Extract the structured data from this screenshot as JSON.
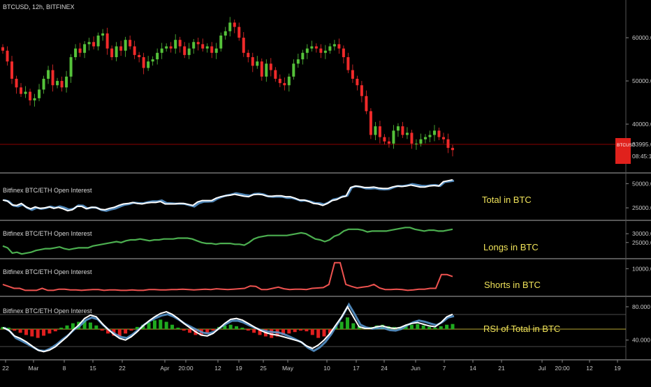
{
  "header": {
    "symbol": "BTCUSD",
    "interval": "12h",
    "exchange": "BITFINEX",
    "title": "BTCUSD, 12h, BITFINEX"
  },
  "colors": {
    "bg": "#000000",
    "up": "#55c23a",
    "down": "#f02a2a",
    "total": "#ffffff",
    "total_shadow": "#5b9bd5",
    "longs": "#4caf50",
    "shorts": "#ef5350",
    "annotation": "#f0e35a",
    "hist_up": "#1faa1f",
    "hist_down": "#e01f1f",
    "price_tag": "#e0211c",
    "rsi_level": "#b8a733"
  },
  "price_tag": {
    "label": "BTCUSD",
    "price": "33995.0",
    "countdown": "08:45:14"
  },
  "chart_data": [
    {
      "type": "candlestick",
      "title": "BTCUSD, 12h, BITFINEX",
      "y_ticks": [
        "60000.0",
        "50000.0",
        "40000.0"
      ],
      "ylim": [
        30000,
        65500
      ],
      "series": [
        {
          "name": "close",
          "values": [
            57000,
            54500,
            50500,
            48500,
            47000,
            47500,
            45500,
            46000,
            48000,
            50500,
            52500,
            49000,
            50000,
            48500,
            51000,
            55500,
            57500,
            56500,
            58500,
            59000,
            58000,
            60500,
            61000,
            57500,
            55500,
            58000,
            57000,
            59500,
            58000,
            56000,
            55500,
            53000,
            54500,
            55000,
            56500,
            57500,
            58000,
            57500,
            59500,
            58000,
            56000,
            57500,
            59000,
            58500,
            57500,
            58000,
            56500,
            57500,
            60500,
            61500,
            63500,
            62500,
            60000,
            56500,
            55500,
            53500,
            54500,
            51000,
            54000,
            52500,
            50500,
            49500,
            49000,
            51000,
            54000,
            55000,
            56500,
            57500,
            58000,
            57500,
            56500,
            57000,
            58000,
            58500,
            57500,
            55500,
            52500,
            50500,
            49000,
            46500,
            43000,
            37500,
            39500,
            37000,
            36000,
            35500,
            38500,
            39500,
            37500,
            38000,
            35500,
            35500,
            36500,
            37000,
            37500,
            38500,
            37000,
            36500,
            34500,
            34000
          ]
        }
      ]
    },
    {
      "type": "line",
      "series": [
        {
          "name": "Total in BTC",
          "values": [
            33000,
            32000,
            28000,
            27500,
            29500,
            26000,
            24000,
            26000,
            24500,
            25000,
            26000,
            24500,
            25500,
            24000,
            22000,
            23000,
            26500,
            26500,
            24000,
            25500,
            25500,
            23500,
            23000,
            24500,
            25500,
            27500,
            29000,
            29500,
            30500,
            29500,
            29000,
            30000,
            30500,
            30500,
            31500,
            29000,
            29000,
            29000,
            29500,
            29500,
            28500,
            27500,
            31000,
            32500,
            32500,
            32500,
            35000,
            36500,
            37500,
            38000,
            39000,
            38000,
            37000,
            36500,
            38500,
            39000,
            38500,
            37000,
            37000,
            37500,
            37500,
            36500,
            36500,
            35000,
            33000,
            33000,
            31500,
            29500,
            29000,
            27500,
            29500,
            32500,
            33500,
            36000,
            37000,
            46000,
            47500,
            47000,
            46000,
            46000,
            46500,
            45500,
            45000,
            45000,
            46500,
            47500,
            47000,
            47500,
            48500,
            47500,
            46500,
            46500,
            47500,
            48000,
            47500,
            52000,
            53000,
            54000
          ]
        }
      ],
      "y_ticks": [
        "50000.000",
        "25000.000"
      ],
      "ylim": [
        20000,
        56000
      ]
    },
    {
      "type": "line",
      "series": [
        {
          "name": "Longs in BTC",
          "values": [
            23000,
            22000,
            19000,
            19500,
            18500,
            19000,
            19500,
            20500,
            21000,
            21500,
            21500,
            22000,
            22500,
            21500,
            21000,
            21500,
            22000,
            22000,
            22000,
            23000,
            23500,
            24000,
            24500,
            25000,
            25500,
            25000,
            26000,
            26500,
            26500,
            27000,
            26500,
            26000,
            26500,
            26500,
            27000,
            27000,
            27000,
            27500,
            27500,
            27500,
            27000,
            26000,
            25000,
            24500,
            24500,
            24000,
            24500,
            24500,
            24500,
            24000,
            24000,
            23500,
            25000,
            27000,
            28000,
            28500,
            29000,
            29000,
            29000,
            29000,
            29000,
            29500,
            30000,
            30500,
            30000,
            28500,
            27000,
            26500,
            25500,
            26500,
            28500,
            29500,
            31500,
            32500,
            32500,
            32500,
            32000,
            31000,
            31500,
            31500,
            31500,
            31500,
            32000,
            32500,
            33000,
            33500,
            33500,
            32500,
            32000,
            31500,
            32000,
            32000,
            31500,
            31500,
            32000,
            32500
          ]
        }
      ],
      "y_ticks": [
        "30000.000",
        "25000.000"
      ],
      "ylim": [
        17000,
        36000
      ]
    },
    {
      "type": "line",
      "series": [
        {
          "name": "Shorts in BTC",
          "values": [
            6000,
            5500,
            5000,
            5000,
            4500,
            4500,
            4500,
            5000,
            4500,
            4500,
            4800,
            4800,
            4600,
            4600,
            4500,
            4600,
            4700,
            4700,
            4500,
            4600,
            4600,
            4500,
            4500,
            4600,
            4500,
            4500,
            4700,
            4700,
            4600,
            4600,
            4700,
            4700,
            4800,
            4700,
            4600,
            4700,
            4800,
            4700,
            4900,
            4800,
            4700,
            4800,
            4900,
            5000,
            5600,
            5500,
            4700,
            4700,
            5000,
            5300,
            4900,
            4700,
            4800,
            4800,
            4700,
            5000,
            5100,
            5200,
            6000,
            11500,
            11500,
            6000,
            5500,
            5100,
            5300,
            5500,
            6000,
            5100,
            4700,
            4700,
            4800,
            4700,
            4500,
            4600,
            4800,
            4800,
            5000,
            5000,
            8500,
            8500,
            8000
          ]
        }
      ],
      "y_ticks": [
        "10000.000"
      ],
      "ylim": [
        3500,
        12000
      ]
    },
    {
      "type": "line",
      "title": "RSI of Total in BTC",
      "series": [
        {
          "name": "RSI of Total in BTC",
          "values": [
            55,
            52,
            45,
            42,
            38,
            33,
            28,
            26,
            28,
            32,
            38,
            44,
            52,
            58,
            66,
            70,
            68,
            60,
            53,
            47,
            42,
            40,
            44,
            50,
            57,
            63,
            68,
            72,
            74,
            71,
            66,
            60,
            55,
            50,
            46,
            45,
            48,
            54,
            60,
            65,
            66,
            64,
            60,
            56,
            52,
            49,
            47,
            46,
            44,
            42,
            40,
            38,
            33,
            30,
            34,
            40,
            48,
            58,
            68,
            80,
            68,
            56,
            54,
            54,
            56,
            57,
            55,
            54,
            55,
            58,
            60,
            61,
            59,
            57,
            56,
            61,
            68,
            71
          ]
        }
      ],
      "hist": [
        3,
        2,
        -2,
        -5,
        -8,
        -10,
        -12,
        -9,
        -6,
        -3,
        2,
        5,
        8,
        10,
        12,
        9,
        5,
        -2,
        -6,
        -9,
        -10,
        -6,
        -2,
        3,
        6,
        9,
        12,
        13,
        10,
        6,
        2,
        -2,
        -5,
        -8,
        -9,
        -6,
        -2,
        3,
        5,
        6,
        4,
        2,
        -2,
        -5,
        -8,
        -10,
        -12,
        -10,
        -8,
        -6,
        -4,
        -2,
        -3,
        -8,
        -12,
        -10,
        -6,
        4,
        10,
        16,
        8,
        4,
        2,
        3,
        5,
        6,
        4,
        3,
        3,
        5,
        6,
        7,
        5,
        3,
        2,
        4,
        6,
        7
      ],
      "y_ticks": [
        "80.000",
        "40.000"
      ],
      "ylim": [
        18,
        90
      ]
    }
  ],
  "panes": [
    {
      "title": "Bitfinex BTC/ETH Open Interest",
      "annotation": "Total in BTC"
    },
    {
      "title": "Bitfinex BTC/ETH Open Interest",
      "annotation": "Longs in BTC"
    },
    {
      "title": "Bitfinex BTC/ETH Open Interest",
      "annotation": "Shorts in BTC"
    },
    {
      "title": "Bitfinex BTC/ETH Open Interest",
      "annotation": "RSI of Total in BTC"
    }
  ],
  "x_axis": {
    "labels": [
      "22",
      "Mar",
      "8",
      "15",
      "22",
      "Apr",
      "20:00",
      "12",
      "19",
      "25",
      "May",
      "10",
      "17",
      "24",
      "Jun",
      "7",
      "14",
      "21",
      "Jul",
      "20:00",
      "12",
      "19"
    ]
  }
}
